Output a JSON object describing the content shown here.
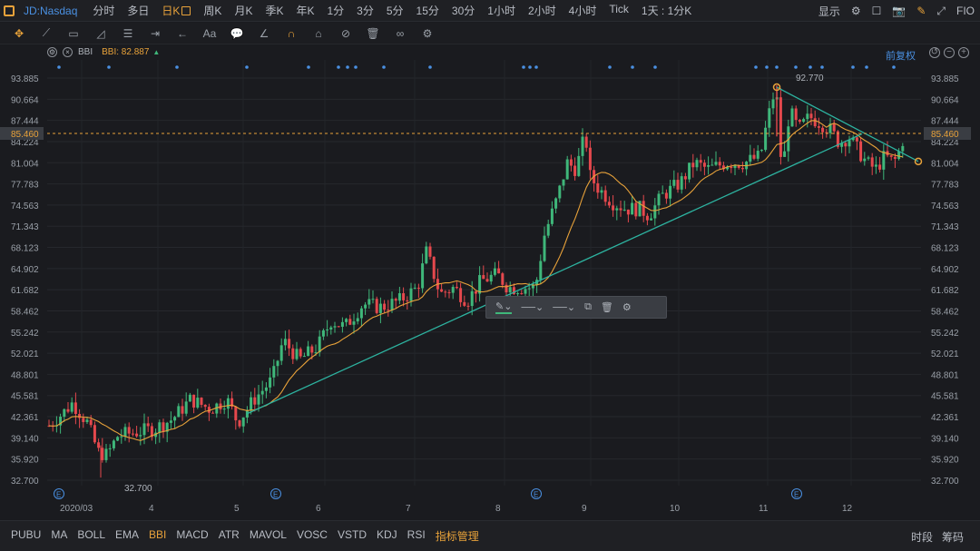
{
  "window": {
    "symbol": "JD:Nasdaq",
    "timeframes": [
      {
        "label": "分时",
        "active": false
      },
      {
        "label": "多日",
        "active": false
      },
      {
        "label": "日K",
        "active": true
      },
      {
        "label": "周K",
        "active": false
      },
      {
        "label": "月K",
        "active": false
      },
      {
        "label": "季K",
        "active": false
      },
      {
        "label": "年K",
        "active": false
      },
      {
        "label": "1分",
        "active": false
      },
      {
        "label": "3分",
        "active": false
      },
      {
        "label": "5分",
        "active": false
      },
      {
        "label": "15分",
        "active": false
      },
      {
        "label": "30分",
        "active": false
      },
      {
        "label": "1小时",
        "active": false
      },
      {
        "label": "2小时",
        "active": false
      },
      {
        "label": "4小时",
        "active": false
      },
      {
        "label": "Tick",
        "active": false
      },
      {
        "label": "1天 : 1分K",
        "active": false
      }
    ],
    "display_label": "显示",
    "fio_label": "FIO"
  },
  "indicator": {
    "name": "BBI",
    "value_label": "BBI: 82.887"
  },
  "reset_label": "前复权",
  "bottom": {
    "indicators": [
      "PUBU",
      "MA",
      "BOLL",
      "EMA",
      "BBI",
      "MACD",
      "ATR",
      "MAVOL",
      "VOSC",
      "VSTD",
      "KDJ",
      "RSI",
      "指标管理"
    ],
    "active": "BBI",
    "right_items": [
      "时段",
      "筹码"
    ]
  },
  "chart_data": {
    "type": "candlestick",
    "symbol": "JD:Nasdaq",
    "y_ticks": [
      93.885,
      90.664,
      87.444,
      84.224,
      81.004,
      77.783,
      74.563,
      71.343,
      68.123,
      64.902,
      61.682,
      58.462,
      55.242,
      52.021,
      48.801,
      45.581,
      42.361,
      39.14,
      35.92,
      32.7
    ],
    "ylim": [
      32.7,
      93.885
    ],
    "x_labels": [
      "2020/03",
      "4",
      "5",
      "6",
      "7",
      "8",
      "9",
      "10",
      "11",
      "12"
    ],
    "current_price": 85.46,
    "annotations": {
      "low_label": "32.700",
      "high_label": "92.770"
    },
    "event_marker": "E",
    "grid": true,
    "colors": {
      "up": "#3fb77a",
      "down": "#e5484d",
      "bbi": "#e8a23a",
      "trendline": "#2db3a0",
      "price_line": "#e8a23a"
    }
  }
}
